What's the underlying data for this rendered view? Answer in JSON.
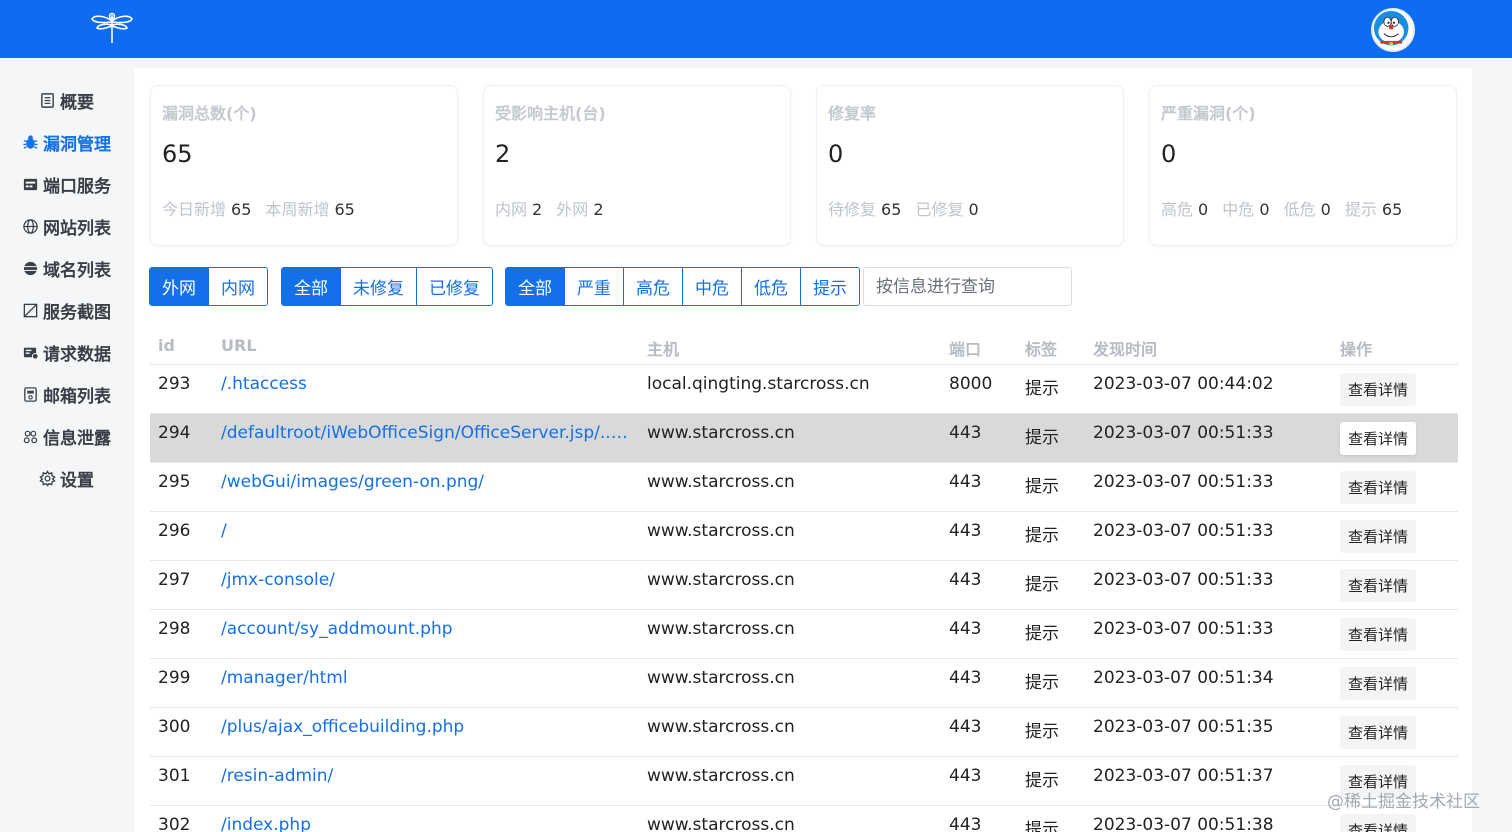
{
  "header": {
    "logo": "dragonfly-logo",
    "avatar": "doraemon-avatar"
  },
  "sidebar": {
    "items": [
      {
        "label": "概要",
        "icon": "document-icon",
        "active": false
      },
      {
        "label": "漏洞管理",
        "icon": "bug-icon",
        "active": true
      },
      {
        "label": "端口服务",
        "icon": "server-icon",
        "active": false
      },
      {
        "label": "网站列表",
        "icon": "globe-icon",
        "active": false
      },
      {
        "label": "域名列表",
        "icon": "domain-icon",
        "active": false
      },
      {
        "label": "服务截图",
        "icon": "screenshot-icon",
        "active": false
      },
      {
        "label": "请求数据",
        "icon": "request-icon",
        "active": false
      },
      {
        "label": "邮箱列表",
        "icon": "mail-icon",
        "active": false
      },
      {
        "label": "信息泄露",
        "icon": "leak-icon",
        "active": false
      },
      {
        "label": "设置",
        "icon": "gear-icon",
        "active": false
      }
    ]
  },
  "cards": [
    {
      "title": "漏洞总数(个)",
      "value": "65",
      "sub": [
        {
          "k": "今日新增",
          "v": "65"
        },
        {
          "k": "本周新增",
          "v": "65"
        }
      ]
    },
    {
      "title": "受影响主机(台)",
      "value": "2",
      "sub": [
        {
          "k": "内网",
          "v": "2"
        },
        {
          "k": "外网",
          "v": "2"
        }
      ]
    },
    {
      "title": "修复率",
      "value": "0",
      "sub": [
        {
          "k": "待修复",
          "v": "65"
        },
        {
          "k": "已修复",
          "v": "0"
        }
      ]
    },
    {
      "title": "严重漏洞(个)",
      "value": "0",
      "sub": [
        {
          "k": "高危",
          "v": "0"
        },
        {
          "k": "中危",
          "v": "0"
        },
        {
          "k": "低危",
          "v": "0"
        },
        {
          "k": "提示",
          "v": "65"
        }
      ]
    }
  ],
  "filters": {
    "network": {
      "options": [
        "外网",
        "内网"
      ],
      "selected": "外网"
    },
    "status": {
      "options": [
        "全部",
        "未修复",
        "已修复"
      ],
      "selected": "全部"
    },
    "severity": {
      "options": [
        "全部",
        "严重",
        "高危",
        "中危",
        "低危",
        "提示"
      ],
      "selected": "全部"
    },
    "search": {
      "placeholder": "按信息进行查询"
    }
  },
  "table": {
    "columns": [
      "id",
      "URL",
      "主机",
      "端口",
      "标签",
      "发现时间",
      "操作"
    ],
    "rows": [
      {
        "id": "293",
        "url": "/.htaccess",
        "host": "local.qingting.starcross.cn",
        "port": "8000",
        "tag": "提示",
        "time": "2023-03-07 00:44:02",
        "action": "查看详情"
      },
      {
        "id": "294",
        "url": "/defaultroot/iWebOfficeSign/OfficeServer.jsp/../...",
        "host": "www.starcross.cn",
        "port": "443",
        "tag": "提示",
        "time": "2023-03-07 00:51:33",
        "action": "查看详情"
      },
      {
        "id": "295",
        "url": "/webGui/images/green-on.png/",
        "host": "www.starcross.cn",
        "port": "443",
        "tag": "提示",
        "time": "2023-03-07 00:51:33",
        "action": "查看详情"
      },
      {
        "id": "296",
        "url": "/",
        "host": "www.starcross.cn",
        "port": "443",
        "tag": "提示",
        "time": "2023-03-07 00:51:33",
        "action": "查看详情"
      },
      {
        "id": "297",
        "url": "/jmx-console/",
        "host": "www.starcross.cn",
        "port": "443",
        "tag": "提示",
        "time": "2023-03-07 00:51:33",
        "action": "查看详情"
      },
      {
        "id": "298",
        "url": "/account/sy_addmount.php",
        "host": "www.starcross.cn",
        "port": "443",
        "tag": "提示",
        "time": "2023-03-07 00:51:33",
        "action": "查看详情"
      },
      {
        "id": "299",
        "url": "/manager/html",
        "host": "www.starcross.cn",
        "port": "443",
        "tag": "提示",
        "time": "2023-03-07 00:51:34",
        "action": "查看详情"
      },
      {
        "id": "300",
        "url": "/plus/ajax_officebuilding.php",
        "host": "www.starcross.cn",
        "port": "443",
        "tag": "提示",
        "time": "2023-03-07 00:51:35",
        "action": "查看详情"
      },
      {
        "id": "301",
        "url": "/resin-admin/",
        "host": "www.starcross.cn",
        "port": "443",
        "tag": "提示",
        "time": "2023-03-07 00:51:37",
        "action": "查看详情"
      },
      {
        "id": "302",
        "url": "/index.php",
        "host": "www.starcross.cn",
        "port": "443",
        "tag": "提示",
        "time": "2023-03-07 00:51:38",
        "action": "查看详情"
      }
    ],
    "hovered_row": "294"
  },
  "watermark": "@稀土掘金技术社区",
  "colors": {
    "brand": "#0e6cf2",
    "link": "#1470e8",
    "row_hover": "#d9d9d9"
  }
}
